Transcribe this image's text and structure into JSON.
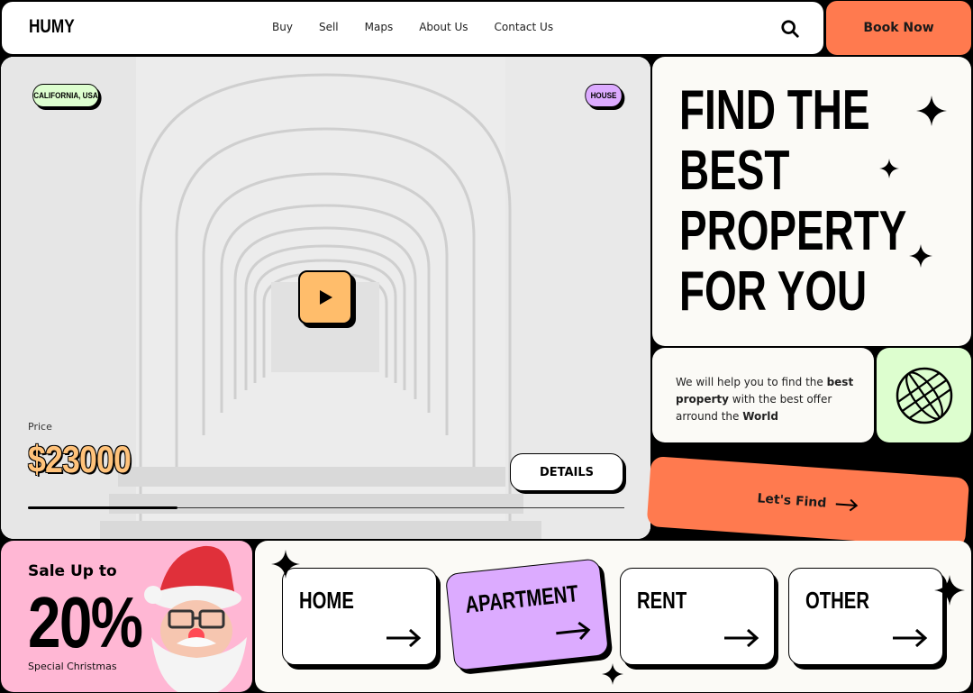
{
  "nav": {
    "logo": "HUMY",
    "items": [
      "Buy",
      "Sell",
      "Maps",
      "About Us",
      "Contact Us"
    ],
    "book_label": "Book Now"
  },
  "hero": {
    "location_tag": "CALIFORNIA, USA",
    "type_tag": "HOUSE",
    "price_label": "Price",
    "price": "$23000",
    "details_label": "DETAILS",
    "progress": 0.25
  },
  "headline": {
    "line1": "FIND THE",
    "line2": "BEST",
    "line3": "PROPERTY",
    "line4": "FOR YOU"
  },
  "description": {
    "t1": "We will help you to find the ",
    "b1": "best property",
    "t2": " with the best offer arround the ",
    "b2": "World"
  },
  "find_label": "Let's Find",
  "sale": {
    "title": "Sale Up to",
    "percent": "20%",
    "subtitle": "Special Christmas"
  },
  "categories": [
    {
      "label": "HOME"
    },
    {
      "label": "APARTMENT"
    },
    {
      "label": "RENT"
    },
    {
      "label": "OTHER"
    }
  ],
  "colors": {
    "accent_orange": "#ff7a4f",
    "accent_green": "#ddfecf",
    "accent_purple": "#dcabff",
    "accent_pink": "#ffb7d4",
    "play_yellow": "#ffbd6b"
  }
}
